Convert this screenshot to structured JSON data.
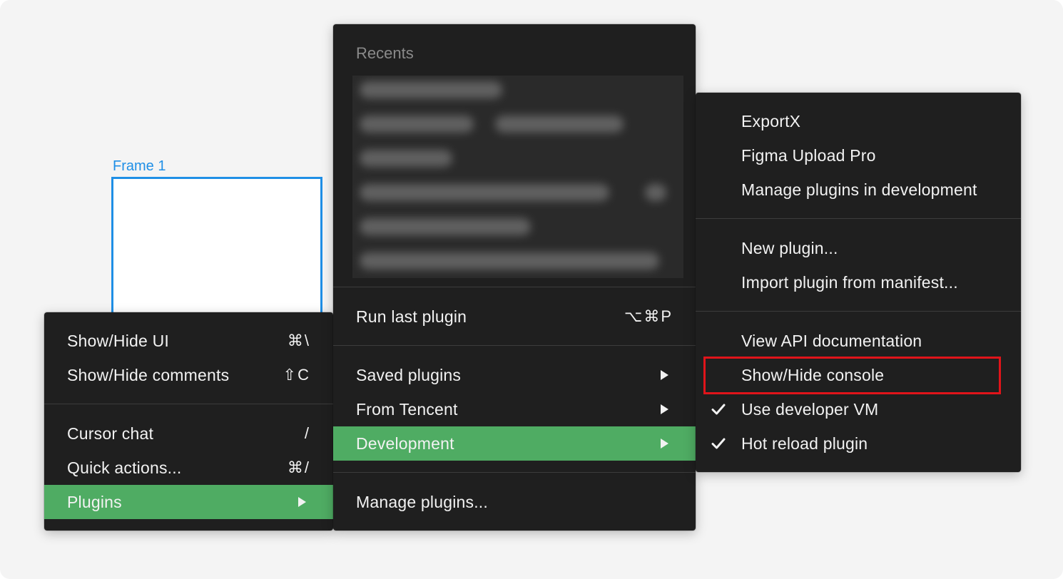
{
  "canvas": {
    "frame_label": "Frame 1"
  },
  "main_menu": {
    "items": [
      {
        "label": "Show/Hide UI",
        "shortcut": "⌘\\"
      },
      {
        "label": "Show/Hide comments",
        "shortcut": "⇧C"
      },
      {
        "label": "Cursor chat",
        "shortcut": "/"
      },
      {
        "label": "Quick actions...",
        "shortcut": "⌘/"
      },
      {
        "label": "Plugins",
        "shortcut": ""
      }
    ]
  },
  "plugins_menu": {
    "recents_header": "Recents",
    "run_last": {
      "label": "Run last plugin",
      "shortcut": "⌥⌘P"
    },
    "items": [
      {
        "label": "Saved plugins"
      },
      {
        "label": "From Tencent"
      },
      {
        "label": "Development"
      }
    ],
    "manage": {
      "label": "Manage plugins..."
    }
  },
  "development_menu": {
    "items": [
      {
        "label": "ExportX"
      },
      {
        "label": "Figma Upload Pro"
      },
      {
        "label": "Manage plugins in development"
      },
      {
        "label": "New plugin..."
      },
      {
        "label": "Import plugin from manifest..."
      },
      {
        "label": "View API documentation"
      },
      {
        "label": "Show/Hide console"
      },
      {
        "label": "Use developer VM"
      },
      {
        "label": "Hot reload plugin"
      }
    ],
    "checked": [
      "Use developer VM",
      "Hot reload plugin"
    ]
  },
  "colors": {
    "menu_bg": "#1f1f1f",
    "active_bg": "#4fac63",
    "frame_accent": "#1f8fe6",
    "highlight": "#e0141a"
  }
}
